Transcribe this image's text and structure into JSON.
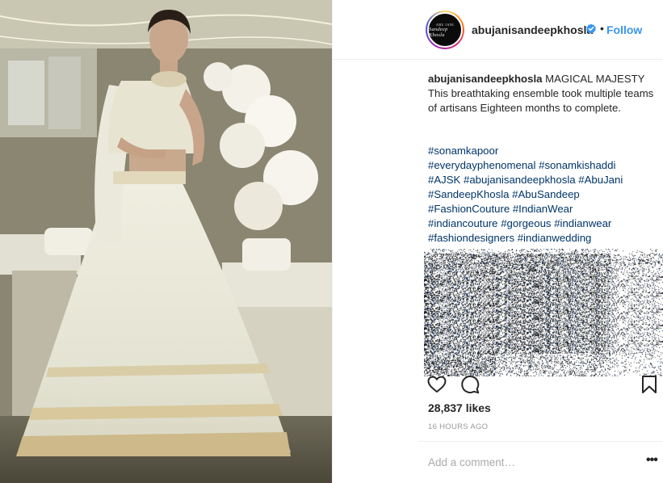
{
  "post": {
    "username": "abujanisandeepkhosla",
    "follow_label": "Follow",
    "separator": "•",
    "avatar_text_top": "ABU JANI",
    "avatar_text_bottom": "Sandeep Khosla",
    "caption_username": "abujanisandeepkhosla",
    "caption_text": "MAGICAL MAJESTY This breathtaking ensemble took multiple teams of artisans Eighteen months to complete.",
    "hashtags": [
      "#sonamkapoor",
      "#everydayphenomenal",
      "#sonamkishaddi",
      "#AJSK",
      "#abujanisandeepkhosla",
      "#AbuJani",
      "#SandeepKhosla",
      "#AbuSandeep",
      "#FashionCouture",
      "#IndianWear",
      "#indiancouture",
      "#gorgeous",
      "#indianwear",
      "#fashiondesigners",
      "#indianwedding"
    ],
    "likes": "28,837 likes",
    "timestamp": "16 HOURS AGO",
    "comment_placeholder": "Add a comment…",
    "more_label": "•••"
  },
  "icons": {
    "verified": "verified-badge-icon",
    "like": "heart-icon",
    "comment": "comment-bubble-icon",
    "save": "bookmark-icon",
    "more": "more-options-icon"
  },
  "colors": {
    "link_blue": "#3897f0",
    "hashtag_blue": "#003569",
    "muted_gray": "#999999",
    "text": "#262626"
  }
}
